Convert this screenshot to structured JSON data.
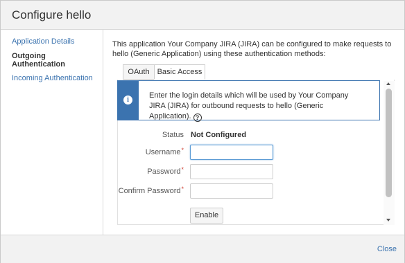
{
  "dialog": {
    "title": "Configure hello"
  },
  "sidebar": {
    "items": [
      {
        "label": "Application Details",
        "active": false
      },
      {
        "label": "Outgoing Authentication",
        "active": true
      },
      {
        "label": "Incoming Authentication",
        "active": false
      }
    ]
  },
  "main": {
    "intro": "This application Your Company JIRA (JIRA) can be configured to make requests to hello (Generic Application) using these authentication methods:",
    "tabs": [
      {
        "label": "OAuth",
        "active": false
      },
      {
        "label": "Basic Access",
        "active": true
      }
    ],
    "info": {
      "icon": "info-icon",
      "text": "Enter the login details which will be used by Your Company JIRA (JIRA) for outbound requests to hello (Generic Application).",
      "help_icon": "?"
    },
    "form": {
      "status_label": "Status",
      "status_value": "Not Configured",
      "username_label": "Username",
      "username_value": "",
      "password_label": "Password",
      "password_value": "",
      "confirm_label": "Confirm Password",
      "confirm_value": "",
      "required_mark": "*",
      "enable_label": "Enable"
    }
  },
  "footer": {
    "close_label": "Close"
  },
  "colors": {
    "link": "#3b73af",
    "info_accent": "#3b73af",
    "required": "#d04437"
  }
}
